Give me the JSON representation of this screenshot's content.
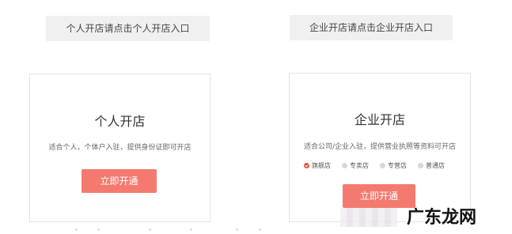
{
  "entrances": {
    "personal_link": "个人开店请点击个人开店入口",
    "company_link": "企业开店请点击企业开店入口"
  },
  "personal_card": {
    "title": "个人开店",
    "description": "适合个人，个体户入驻，提供身份证即可开店",
    "cta": "立即开通"
  },
  "company_card": {
    "title": "企业开店",
    "description": "适合公司/企业入驻，提供营业执照等资料可开店",
    "store_types": [
      {
        "label": "旗舰店",
        "selected": true
      },
      {
        "label": "专卖店",
        "selected": false
      },
      {
        "label": "专营店",
        "selected": false
      },
      {
        "label": "普通店",
        "selected": false
      }
    ],
    "cta": "立即开通"
  },
  "watermark": "广东龙网",
  "colors": {
    "accent": "#f47a70",
    "selected_radio": "#e3463b",
    "link_bg": "#f0f0f0"
  }
}
